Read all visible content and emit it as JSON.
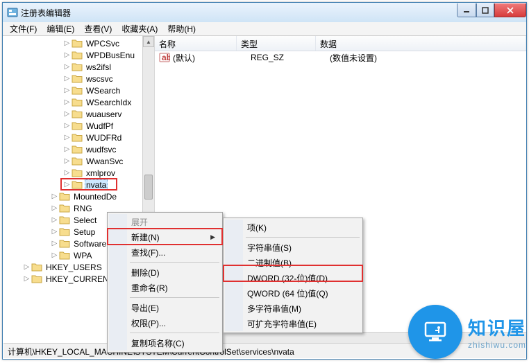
{
  "window": {
    "title": "注册表编辑器"
  },
  "menu": {
    "file": "文件(F)",
    "edit": "编辑(E)",
    "view": "查看(V)",
    "fav": "收藏夹(A)",
    "help": "帮助(H)"
  },
  "tree": {
    "items": [
      "WPCSvc",
      "WPDBusEnu",
      "ws2ifsl",
      "wscsvc",
      "WSearch",
      "WSearchIdx",
      "wuauserv",
      "WudfPf",
      "WUDFRd",
      "wudfsvc",
      "WwanSvc",
      "xmlprov",
      "nvata"
    ],
    "after": [
      "MountedDe",
      "RNG",
      "Select",
      "Setup",
      "Software",
      "WPA"
    ],
    "roots": [
      "HKEY_USERS",
      "HKEY_CURRENT_"
    ]
  },
  "list": {
    "cols": {
      "name": "名称",
      "type": "类型",
      "data": "数据"
    },
    "rows": [
      {
        "name": "(默认)",
        "type": "REG_SZ",
        "data": "(数值未设置)"
      }
    ]
  },
  "ctx1": {
    "expand": "展开",
    "new": "新建(N)",
    "find": "查找(F)...",
    "delete": "删除(D)",
    "rename": "重命名(R)",
    "export": "导出(E)",
    "perm": "权限(P)...",
    "copykey": "复制项名称(C)"
  },
  "ctx2": {
    "key": "项(K)",
    "string": "字符串值(S)",
    "binary": "二进制值(B)",
    "dword": "DWORD (32-位)值(D)",
    "qword": "QWORD (64 位)值(Q)",
    "multi": "多字符串值(M)",
    "expand": "可扩充字符串值(E)"
  },
  "status": "计算机\\HKEY_LOCAL_MACHINE\\SYSTEM\\CurrentControlSet\\services\\nvata",
  "watermark": {
    "big": "知识屋",
    "small": "zhishiwu.com"
  }
}
